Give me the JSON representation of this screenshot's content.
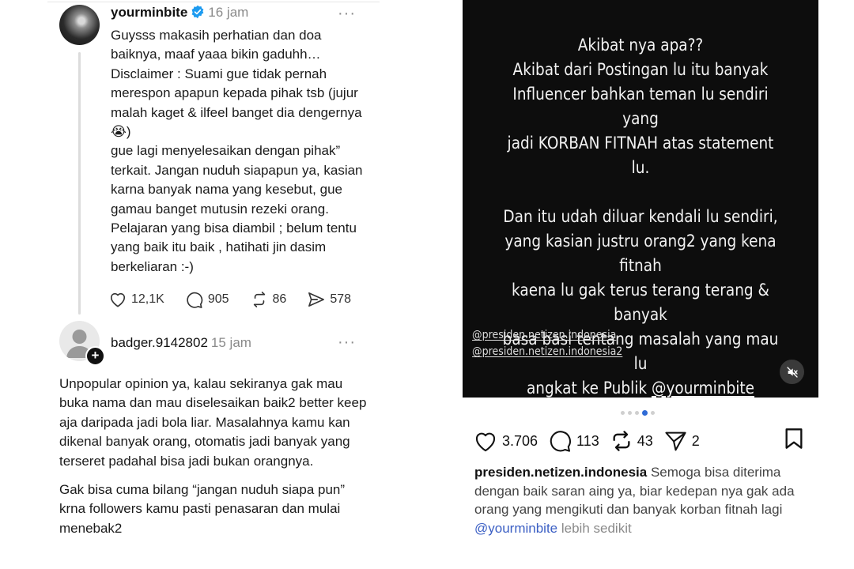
{
  "left_post": {
    "username": "yourminbite",
    "time": "16 jam",
    "more_label": "···",
    "text": "Guysss makasih perhatian dan doa baiknya, maaf yaaa bikin gaduhh… Disclaimer : Suami gue tidak pernah merespon apapun kepada pihak tsb (jujur malah kaget & ilfeel banget dia dengernya😭)\ngue lagi menyelesaikan dengan pihak” terkait. Jangan nuduh siapapun ya, kasian karna banyak nama yang kesebut, gue gamau banget mutusin rezeki orang. Pelajaran yang bisa diambil ; belum tentu yang baik itu baik , hatihati jin dasim berkeliaran :-)",
    "likes": "12,1K",
    "comments": "905",
    "reposts": "86",
    "shares": "578"
  },
  "reply": {
    "username": "badger.9142802",
    "time": "15 jam",
    "more_label": "···",
    "plus_label": "+",
    "paragraph1": "Unpopular opinion ya, kalau sekiranya gak mau buka nama dan mau diselesaikan baik2 better keep aja daripada jadi bola liar. Masalahnya kamu kan dikenal banyak orang, otomatis jadi banyak yang terseret padahal bisa jadi bukan orangnya.",
    "paragraph2": "Gak bisa cuma bilang “jangan nuduh siapa pun” krna followers kamu pasti penasaran dan mulai menebak2"
  },
  "story": {
    "line1": "Akibat nya apa??",
    "line2": "Akibat dari Postingan lu itu banyak",
    "line3": "Influencer bahkan teman lu sendiri yang",
    "line4": "jadi KORBAN FITNAH atas statement lu.",
    "line5": "Dan itu udah diluar kendali lu sendiri,",
    "line6": "yang kasian justru orang2 yang kena fitnah",
    "line7": "kaena lu gak terus terang terang & banyak",
    "line8": "basa basi tentang masalah yang mau lu",
    "line9_prefix": "angkat ke Publik ",
    "line9_mention": "@yourminbite",
    "tag1": "@presiden.netizen.indonesia",
    "tag2": "@presiden.netizen.indonesia2"
  },
  "ig": {
    "likes": "3.706",
    "comments": "113",
    "reposts": "43",
    "shares": "2",
    "caption_user": "presiden.netizen.indonesia",
    "caption_text": " Semoga bisa diterima dengan baik saran aing ya, biar kedepan nya gak ada orang yang mengikuti dan banyak korban fitnah lagi ",
    "caption_mention": "@yourminbite",
    "caption_more": " lebih sedikit",
    "carousel_active_index": 4,
    "carousel_count": 5
  },
  "colors": {
    "verified": "#1d9bf0",
    "mention": "#3b5fc4",
    "carousel_active": "#2f6bd6"
  }
}
